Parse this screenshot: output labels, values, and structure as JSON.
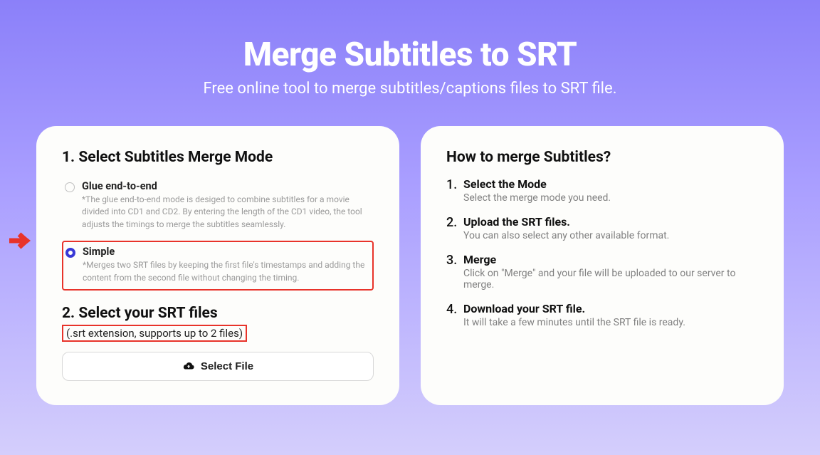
{
  "header": {
    "title": "Merge Subtitles to SRT",
    "subtitle": "Free online tool to merge subtitles/captions files to SRT file."
  },
  "left": {
    "section1_title": "1. Select Subtitles Merge Mode",
    "options": [
      {
        "label": "Glue end-to-end",
        "desc": "*The glue end-to-end mode is desiged to combine subtitles for a movie divided into CD1 and CD2. By entering the length of the CD1 video, the tool adjusts the timings to merge the subtitles seamlessly.",
        "selected": false
      },
      {
        "label": "Simple",
        "desc": "*Merges two SRT files by keeping the first file's timestamps and adding the content from the second file without changing the timing.",
        "selected": true
      }
    ],
    "section2_title": "2. Select your SRT files",
    "file_hint": "(.srt extension, supports up to 2 files)",
    "select_button": "Select File"
  },
  "right": {
    "title": "How to merge Subtitles?",
    "steps": [
      {
        "title": "Select the Mode",
        "desc": "Select the merge mode you need."
      },
      {
        "title": "Upload the SRT files.",
        "desc": "You can also select any other available format."
      },
      {
        "title": "Merge",
        "desc": "Click on \"Merge\" and your file will be uploaded to our server to merge."
      },
      {
        "title": "Download your SRT file.",
        "desc": "It will take a few minutes until the SRT file is ready."
      }
    ]
  }
}
